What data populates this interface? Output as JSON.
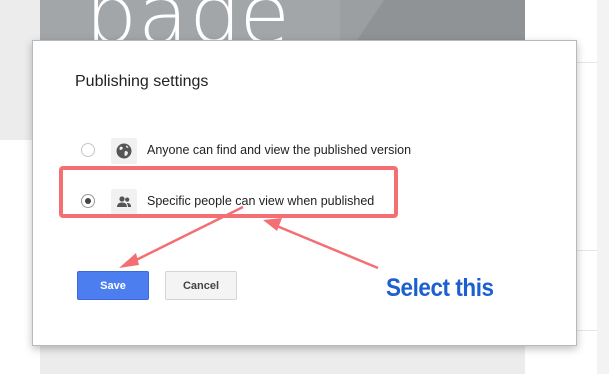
{
  "background": {
    "banner_text": "page"
  },
  "dialog": {
    "title": "Publishing settings",
    "options": [
      {
        "label": "Anyone can find and view the published version",
        "icon": "globe-icon",
        "selected": false
      },
      {
        "label": "Specific people can view when published",
        "icon": "people-icon",
        "selected": true
      }
    ],
    "buttons": {
      "save_label": "Save",
      "cancel_label": "Cancel"
    }
  },
  "annotation": {
    "callout_text": "Select this",
    "highlight_color": "#f36f73",
    "callout_color": "#1b5fd1"
  },
  "colors": {
    "save_button": "#4d7ef0",
    "cancel_button": "#f4f4f4"
  }
}
